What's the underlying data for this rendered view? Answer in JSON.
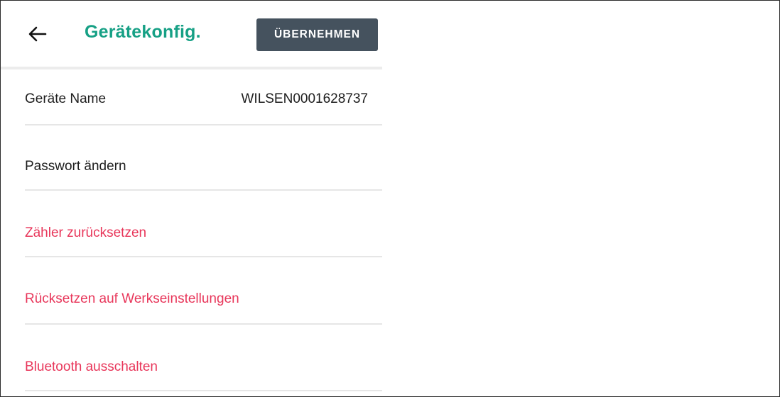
{
  "header": {
    "back_icon": "arrow-left-icon",
    "title": "Gerätekonfig.",
    "apply_label": "ÜBERNEHMEN"
  },
  "device_name": {
    "label": "Geräte Name",
    "value": "WILSEN0001628737"
  },
  "menu": {
    "change_password": "Passwort ändern",
    "reset_counter": "Zähler zurücksetzen",
    "factory_reset": "Rücksetzen auf Werkseinstellungen",
    "bluetooth_off": "Bluetooth ausschalten"
  },
  "colors": {
    "title": "#16a085",
    "button": "#45525e",
    "destructive": "#e8365a"
  }
}
